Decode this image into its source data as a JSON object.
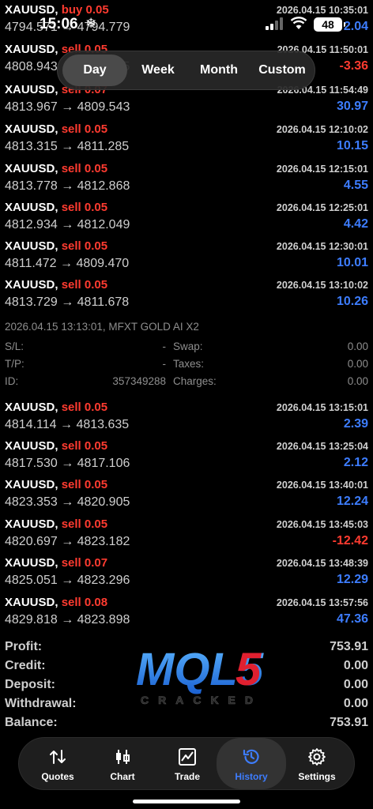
{
  "status": {
    "time": "15:06",
    "battery": "48"
  },
  "periods": {
    "day": "Day",
    "week": "Week",
    "month": "Month",
    "custom": "Custom"
  },
  "trades": [
    {
      "symbol": "XAUUSD,",
      "side": "buy 0.05",
      "open": "4794.571",
      "close": "4794.779",
      "time": "2026.04.15 10:35:01",
      "profit": "2.04",
      "dir": "pos"
    },
    {
      "symbol": "XAUUSD,",
      "side": "sell 0.05",
      "open": "4808.943",
      "close": "4809.615",
      "time": "2026.04.15 11:50:01",
      "profit": "-3.36",
      "dir": "neg"
    },
    {
      "symbol": "XAUUSD,",
      "side": "sell 0.07",
      "open": "4813.967",
      "close": "4809.543",
      "time": "2026.04.15 11:54:49",
      "profit": "30.97",
      "dir": "pos"
    },
    {
      "symbol": "XAUUSD,",
      "side": "sell 0.05",
      "open": "4813.315",
      "close": "4811.285",
      "time": "2026.04.15 12:10:02",
      "profit": "10.15",
      "dir": "pos"
    },
    {
      "symbol": "XAUUSD,",
      "side": "sell 0.05",
      "open": "4813.778",
      "close": "4812.868",
      "time": "2026.04.15 12:15:01",
      "profit": "4.55",
      "dir": "pos"
    },
    {
      "symbol": "XAUUSD,",
      "side": "sell 0.05",
      "open": "4812.934",
      "close": "4812.049",
      "time": "2026.04.15 12:25:01",
      "profit": "4.42",
      "dir": "pos"
    },
    {
      "symbol": "XAUUSD,",
      "side": "sell 0.05",
      "open": "4811.472",
      "close": "4809.470",
      "time": "2026.04.15 12:30:01",
      "profit": "10.01",
      "dir": "pos"
    },
    {
      "symbol": "XAUUSD,",
      "side": "sell 0.05",
      "open": "4813.729",
      "close": "4811.678",
      "time": "2026.04.15 13:10:02",
      "profit": "10.26",
      "dir": "pos"
    },
    {
      "symbol": "XAUUSD,",
      "side": "sell 0.05",
      "open": "4814.114",
      "close": "4813.635",
      "time": "2026.04.15 13:15:01",
      "profit": "2.39",
      "dir": "pos"
    },
    {
      "symbol": "XAUUSD,",
      "side": "sell 0.05",
      "open": "4817.530",
      "close": "4817.106",
      "time": "2026.04.15 13:25:04",
      "profit": "2.12",
      "dir": "pos"
    },
    {
      "symbol": "XAUUSD,",
      "side": "sell 0.05",
      "open": "4823.353",
      "close": "4820.905",
      "time": "2026.04.15 13:40:01",
      "profit": "12.24",
      "dir": "pos"
    },
    {
      "symbol": "XAUUSD,",
      "side": "sell 0.05",
      "open": "4820.697",
      "close": "4823.182",
      "time": "2026.04.15 13:45:03",
      "profit": "-12.42",
      "dir": "neg"
    },
    {
      "symbol": "XAUUSD,",
      "side": "sell 0.07",
      "open": "4825.051",
      "close": "4823.296",
      "time": "2026.04.15 13:48:39",
      "profit": "12.29",
      "dir": "pos"
    },
    {
      "symbol": "XAUUSD,",
      "side": "sell 0.08",
      "open": "4829.818",
      "close": "4823.898",
      "time": "2026.04.15 13:57:56",
      "profit": "47.36",
      "dir": "pos"
    }
  ],
  "detail": {
    "header": "2026.04.15 13:13:01, MFXT GOLD AI X2",
    "sl_label": "S/L:",
    "sl_value": "-",
    "tp_label": "T/P:",
    "tp_value": "-",
    "id_label": "ID:",
    "id_value": "357349288",
    "swap_label": "Swap:",
    "swap_value": "0.00",
    "taxes_label": "Taxes:",
    "taxes_value": "0.00",
    "charges_label": "Charges:",
    "charges_value": "0.00"
  },
  "summary": [
    {
      "label": "Profit:",
      "value": "753.91"
    },
    {
      "label": "Credit:",
      "value": "0.00"
    },
    {
      "label": "Deposit:",
      "value": "0.00"
    },
    {
      "label": "Withdrawal:",
      "value": "0.00"
    },
    {
      "label": "Balance:",
      "value": "753.91"
    }
  ],
  "watermark": {
    "main": "MQL5",
    "sub": "CRACKED"
  },
  "tabs": [
    {
      "label": "Quotes",
      "icon": "quotes-icon"
    },
    {
      "label": "Chart",
      "icon": "chart-icon"
    },
    {
      "label": "Trade",
      "icon": "trade-icon"
    },
    {
      "label": "History",
      "icon": "history-icon"
    },
    {
      "label": "Settings",
      "icon": "settings-icon"
    }
  ],
  "colors": {
    "profit_positive": "#3d7dff",
    "profit_negative": "#ff3b30",
    "side": "#ff3b30",
    "active_tab": "#3d7dff"
  }
}
